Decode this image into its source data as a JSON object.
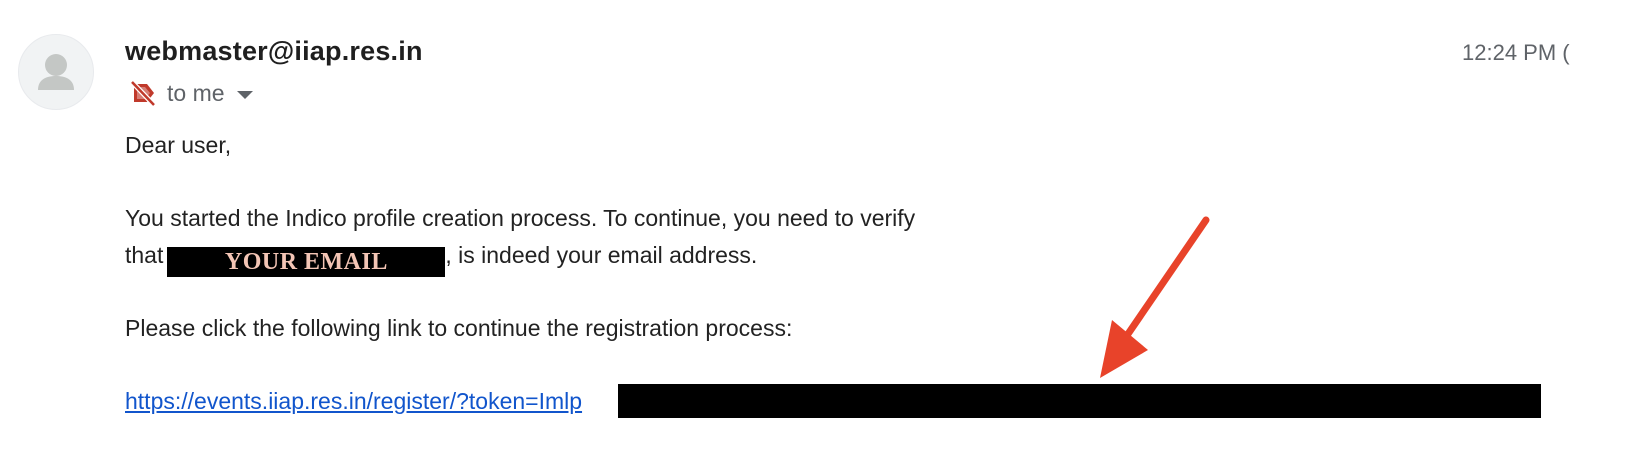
{
  "email": {
    "sender": "webmaster@iiap.res.in",
    "timestamp": "12:24 PM (",
    "recipient_label": "to me",
    "icons": {
      "avatar": "person-icon",
      "label": "label-off-icon",
      "caret": "chevron-down-icon"
    },
    "body": {
      "greeting": "Dear user,",
      "line1": "You started the Indico profile creation process. To continue, you need to verify",
      "line2_prefix": "that",
      "redacted_email_overlay": "YOUR EMAIL",
      "line2_suffix": ", is indeed your email address.",
      "line3": "Please click the following link to continue the registration process:",
      "link_text": "https://events.iiap.res.in/register/?token=Imlp"
    }
  },
  "annotations": {
    "arrow_color": "#e8432a",
    "redaction_color": "#000000"
  }
}
